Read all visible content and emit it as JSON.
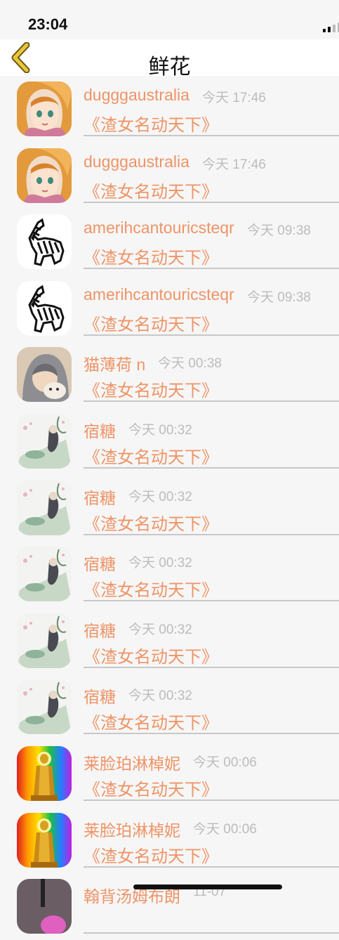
{
  "status_bar": {
    "time": "23:04"
  },
  "nav": {
    "title": "鲜花",
    "back_icon": "chevron-left-icon"
  },
  "colors": {
    "accent": "#ee9467",
    "time_gray": "#bcbcbc",
    "divider": "#c8c8c8"
  },
  "list": [
    {
      "name": "dugggaustralia",
      "time": "今天 17:46",
      "gift": "《渣女名动天下》",
      "avatar": "anime-girl"
    },
    {
      "name": "dugggaustralia",
      "time": "今天 17:46",
      "gift": "《渣女名动天下》",
      "avatar": "anime-girl"
    },
    {
      "name": "amerihcantouricsteqr",
      "time": "今天 09:38",
      "gift": "《渣女名动天下》",
      "avatar": "zebra"
    },
    {
      "name": "amerihcantouricsteqr",
      "time": "今天 09:38",
      "gift": "《渣女名动天下》",
      "avatar": "zebra"
    },
    {
      "name": "猫薄荷 n",
      "time": "今天 00:38",
      "gift": "《渣女名动天下》",
      "avatar": "hooded-person"
    },
    {
      "name": "宿糖",
      "time": "今天 00:32",
      "gift": "《渣女名动天下》",
      "avatar": "ink-painting"
    },
    {
      "name": "宿糖",
      "time": "今天 00:32",
      "gift": "《渣女名动天下》",
      "avatar": "ink-painting"
    },
    {
      "name": "宿糖",
      "time": "今天 00:32",
      "gift": "《渣女名动天下》",
      "avatar": "ink-painting"
    },
    {
      "name": "宿糖",
      "time": "今天 00:32",
      "gift": "《渣女名动天下》",
      "avatar": "ink-painting"
    },
    {
      "name": "宿糖",
      "time": "今天 00:32",
      "gift": "《渣女名动天下》",
      "avatar": "ink-painting"
    },
    {
      "name": "莱脸珀淋棹妮",
      "time": "今天 00:06",
      "gift": "《渣女名动天下》",
      "avatar": "golden-buddha"
    },
    {
      "name": "莱脸珀淋棹妮",
      "time": "今天 00:06",
      "gift": "《渣女名动天下》",
      "avatar": "golden-buddha"
    },
    {
      "name": "翰背汤姆布朗",
      "time": "11-07",
      "gift": "",
      "avatar": "dark-figure"
    }
  ]
}
